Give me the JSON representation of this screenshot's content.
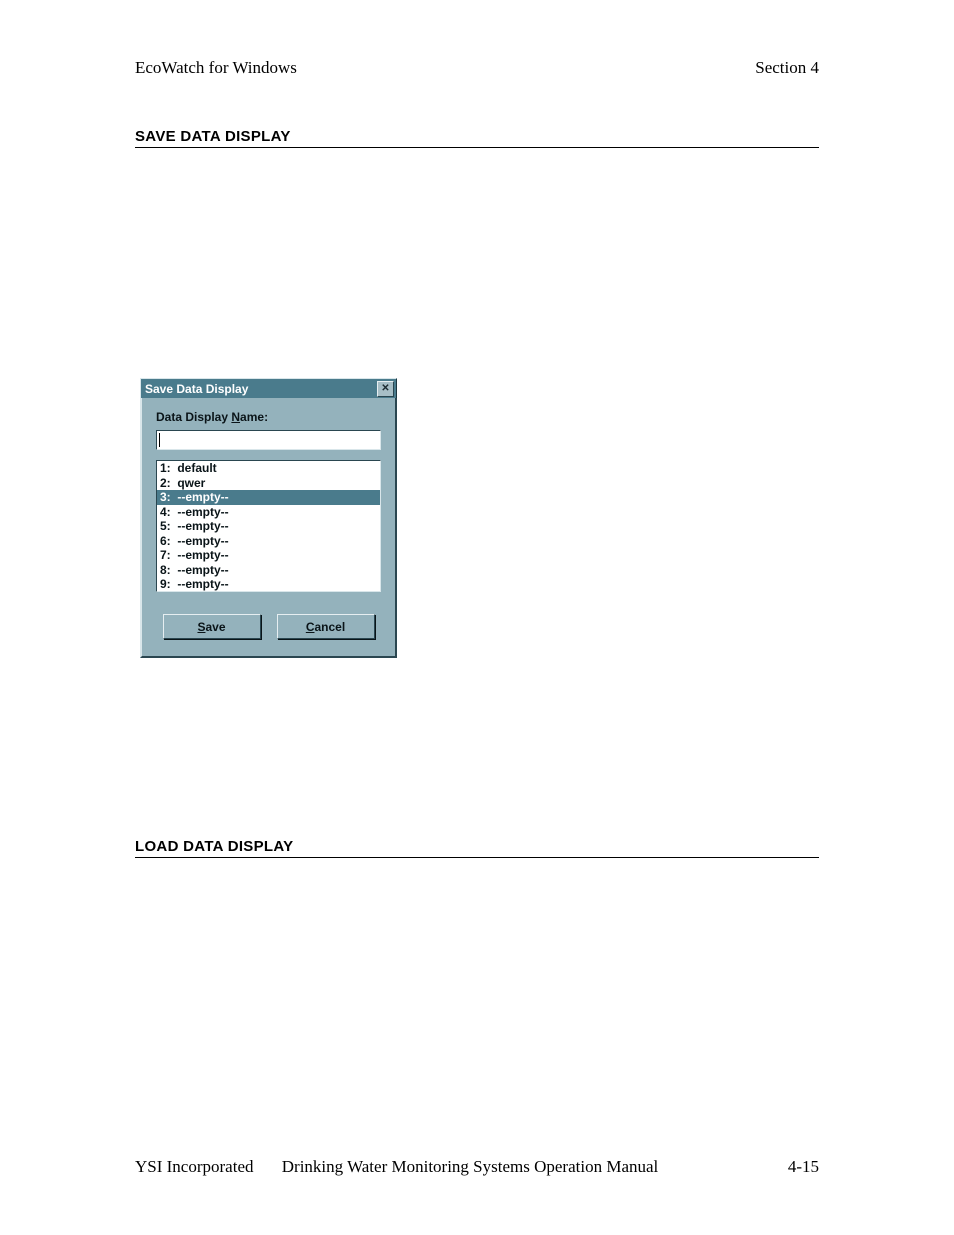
{
  "header": {
    "left": "EcoWatch for Windows",
    "right": "Section 4"
  },
  "section1": {
    "heading": "SAVE DATA DISPLAY"
  },
  "section2": {
    "heading": "LOAD DATA DISPLAY"
  },
  "dialog": {
    "title": "Save Data Display",
    "label_pre": "Data Display ",
    "label_u": "N",
    "label_post": "ame:",
    "input_value": "",
    "items": [
      {
        "text": "1:  default",
        "selected": false
      },
      {
        "text": "2:  qwer",
        "selected": false
      },
      {
        "text": "3:  --empty--",
        "selected": true
      },
      {
        "text": "4:  --empty--",
        "selected": false
      },
      {
        "text": "5:  --empty--",
        "selected": false
      },
      {
        "text": "6:  --empty--",
        "selected": false
      },
      {
        "text": "7:  --empty--",
        "selected": false
      },
      {
        "text": "8:  --empty--",
        "selected": false
      },
      {
        "text": "9:  --empty--",
        "selected": false
      }
    ],
    "save_u": "S",
    "save_rest": "ave",
    "cancel_u": "C",
    "cancel_rest": "ancel",
    "close_glyph": "✕"
  },
  "footer": {
    "company": "YSI Incorporated",
    "manual": "Drinking Water Monitoring Systems Operation Manual",
    "page": "4-15"
  }
}
